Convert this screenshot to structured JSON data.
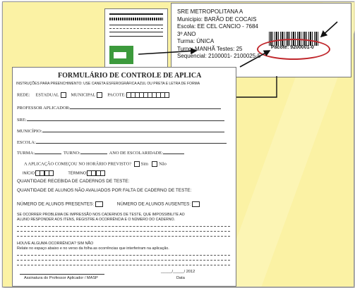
{
  "label": {
    "lines": [
      "SRE METROPOLITANA  A",
      "Municipio: BARÃO DE COCAIS",
      "Escola: EE CEL CANCIO -  7684",
      "3º ANO",
      "Turma: ÚNICA",
      "Turno: MANHÃ  Testes: 25",
      "Sequencial: 2100001- 2100025-5"
    ],
    "pacote": "Pacote: 9200001-0"
  },
  "form": {
    "title": "FORMULÁRIO DE CONTROLE DE APLICA",
    "instructions": "INSTRUÇÕES PARA PREENCHIMENTO:   USE CANETA ESFEROGRÁFICA  AZUL OU PRETA E LETRA  DE FORMA",
    "rede": "REDE:",
    "estadual": "ESTADUAL",
    "municipal": "MUNICIPAL",
    "pacote": "PACOTE:",
    "professor": "PROFESSOR APLICADOR:",
    "sre": "SRE:",
    "municipio": "MUNICÍPIO:",
    "escola": "ESCOLA:",
    "turma": "TURMA:",
    "turno": "TURNO:",
    "ano": "ANO DE ESCOLARIDADE:",
    "horario": "A APLICAÇÃO COMEÇOU NO HORÁRIO PREVISTO?",
    "sim": "Sim",
    "nao": "Não",
    "inicio": "INÍCIO:",
    "termino": "TÉRMINO:",
    "recebida": "QUANTIDADE  RECEBIDA DE CADERNOS DE TESTE:",
    "nao_avaliados": "QUANTIDADE DE ALUNOS NÃO AVALIADOS POR FALTA DE CADERNO DE TESTE:",
    "presentes": "NÚMERO DE ALUNOS PRESENTES:",
    "ausentes": "NÚMERO DE ALUNOS AUSENTES:",
    "problema1": "SE OCORRER PROBLEMA DE IMPRESSÃO NOS CADERNOS DE TESTE, QUE IMPOSSIBILITE  AO",
    "problema2": "ALUNO RESPONDER AOS ITENS, REGISTRE A OCORRÊNCIA E O NÚMERO  DO CADERNO.",
    "ocorrencia": "HOUVE ALGUMA  OCORRÊNCIA?       SIM            NÃO",
    "relate": "Relate no espaço abaixo e no verso da folha as ocorrências que interferiram na aplicação.",
    "date": "_____/_____/ 2012",
    "assinatura": "Assinatura do Professor Aplicador / MASP",
    "data": "Data"
  }
}
